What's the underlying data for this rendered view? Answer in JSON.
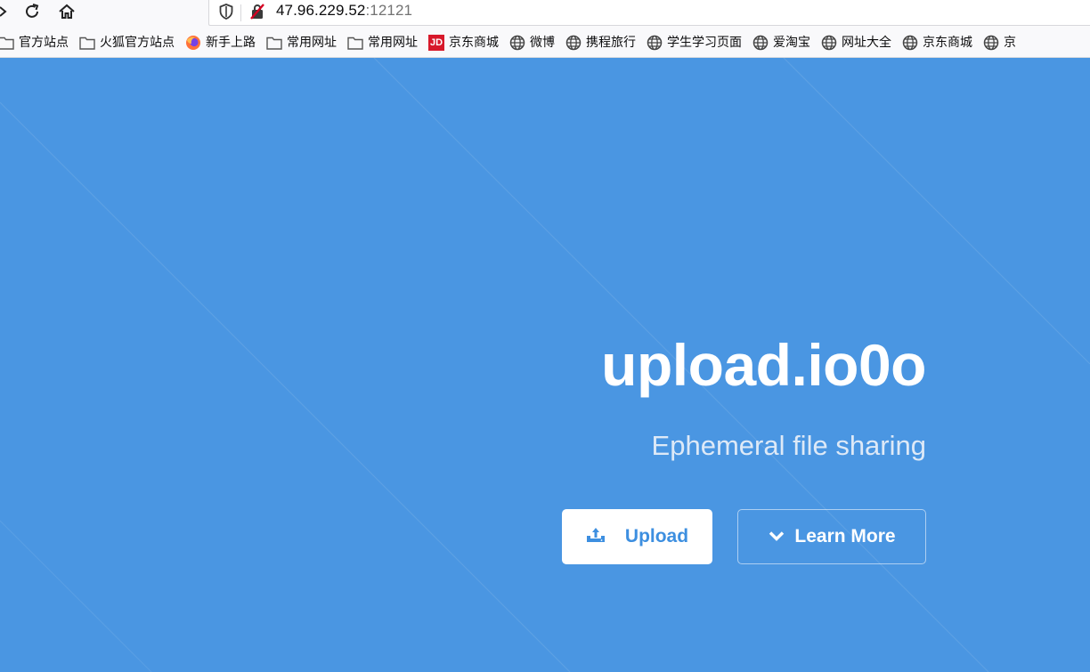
{
  "browser": {
    "url_host": "47.96.229.52",
    "url_port": ":12121",
    "bookmarks": [
      {
        "label": "官方站点",
        "icon": "folder-icon"
      },
      {
        "label": "火狐官方站点",
        "icon": "folder-icon"
      },
      {
        "label": "新手上路",
        "icon": "firefox-icon"
      },
      {
        "label": "常用网址",
        "icon": "folder-icon"
      },
      {
        "label": "常用网址",
        "icon": "folder-icon"
      },
      {
        "label": "京东商城",
        "icon": "jd-icon",
        "icon_text": "JD"
      },
      {
        "label": "微博",
        "icon": "globe-icon"
      },
      {
        "label": "携程旅行",
        "icon": "globe-icon"
      },
      {
        "label": "学生学习页面",
        "icon": "globe-icon"
      },
      {
        "label": "爱淘宝",
        "icon": "globe-icon"
      },
      {
        "label": "网址大全",
        "icon": "globe-icon"
      },
      {
        "label": "京东商城",
        "icon": "globe-icon"
      },
      {
        "label": "京",
        "icon": "globe-icon"
      }
    ]
  },
  "hero": {
    "title": "upload.io0o",
    "subtitle": "Ephemeral file sharing",
    "upload_label": "Upload",
    "learn_more_label": "Learn More"
  },
  "colors": {
    "page_background": "#4a96e2",
    "upload_text": "#3d8fe0",
    "jd_red": "#d7182a",
    "shield_red": "#d70022"
  }
}
